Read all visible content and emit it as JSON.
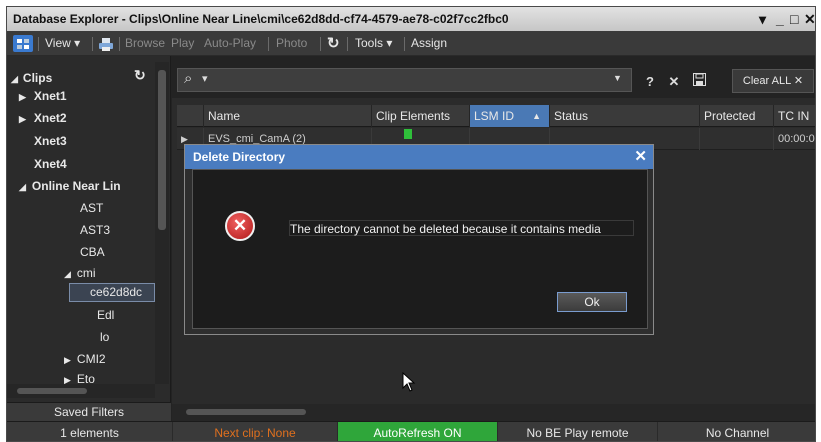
{
  "window": {
    "title": "Database Explorer - Clips\\Online Near Line\\cmi\\ce62d8dd-cf74-4579-ae78-c02f7cc2fbc0",
    "controls": [
      "▾",
      "_",
      "□",
      "✕"
    ]
  },
  "toolbar": {
    "view": "View ▾",
    "browse": "Browse",
    "play": "Play",
    "auto_play": "Auto-Play",
    "photo": "Photo",
    "tools": "Tools ▾",
    "assign": "Assign"
  },
  "tree": {
    "root": "Clips",
    "items": [
      {
        "label": "Xnet1",
        "bold": true
      },
      {
        "label": "Xnet2",
        "bold": true
      },
      {
        "label": "Xnet3",
        "bold": true
      },
      {
        "label": "Xnet4",
        "bold": true
      },
      {
        "label": "Online Near Lin",
        "bold": true
      },
      {
        "label": "AST",
        "bold": false
      },
      {
        "label": "AST3",
        "bold": false
      },
      {
        "label": "CBA",
        "bold": false
      },
      {
        "label": "cmi",
        "bold": false
      },
      {
        "label": "ce62d8dc",
        "bold": false
      },
      {
        "label": "Edl",
        "bold": false
      },
      {
        "label": "lo",
        "bold": false
      },
      {
        "label": "CMI2",
        "bold": false
      },
      {
        "label": "Eto",
        "bold": false
      }
    ],
    "saved_filters": "Saved Filters"
  },
  "search": {
    "query": "",
    "clear_all": "Clear ALL ✕"
  },
  "table": {
    "columns": [
      "Name",
      "Clip Elements",
      "LSM ID",
      "Status",
      "Protected",
      "TC IN"
    ],
    "sorted_column": "LSM ID",
    "rows": [
      {
        "name": "EVS_cmi_CamA (2)",
        "tc_in": "00:00:0"
      }
    ]
  },
  "status": {
    "elements": "1 elements",
    "next_clip": "Next clip: None",
    "autorefresh": "AutoRefresh ON",
    "play_remote": "No BE Play remote",
    "channel": "No Channel"
  },
  "dialog": {
    "title": "Delete Directory",
    "message": "The directory cannot be deleted because it contains media",
    "ok": "Ok"
  },
  "colors": {
    "accent": "#4a7cc0",
    "next_clip": "#e0701e",
    "autorefresh_bg": "#2fa63a",
    "error": "#c41e1e"
  }
}
